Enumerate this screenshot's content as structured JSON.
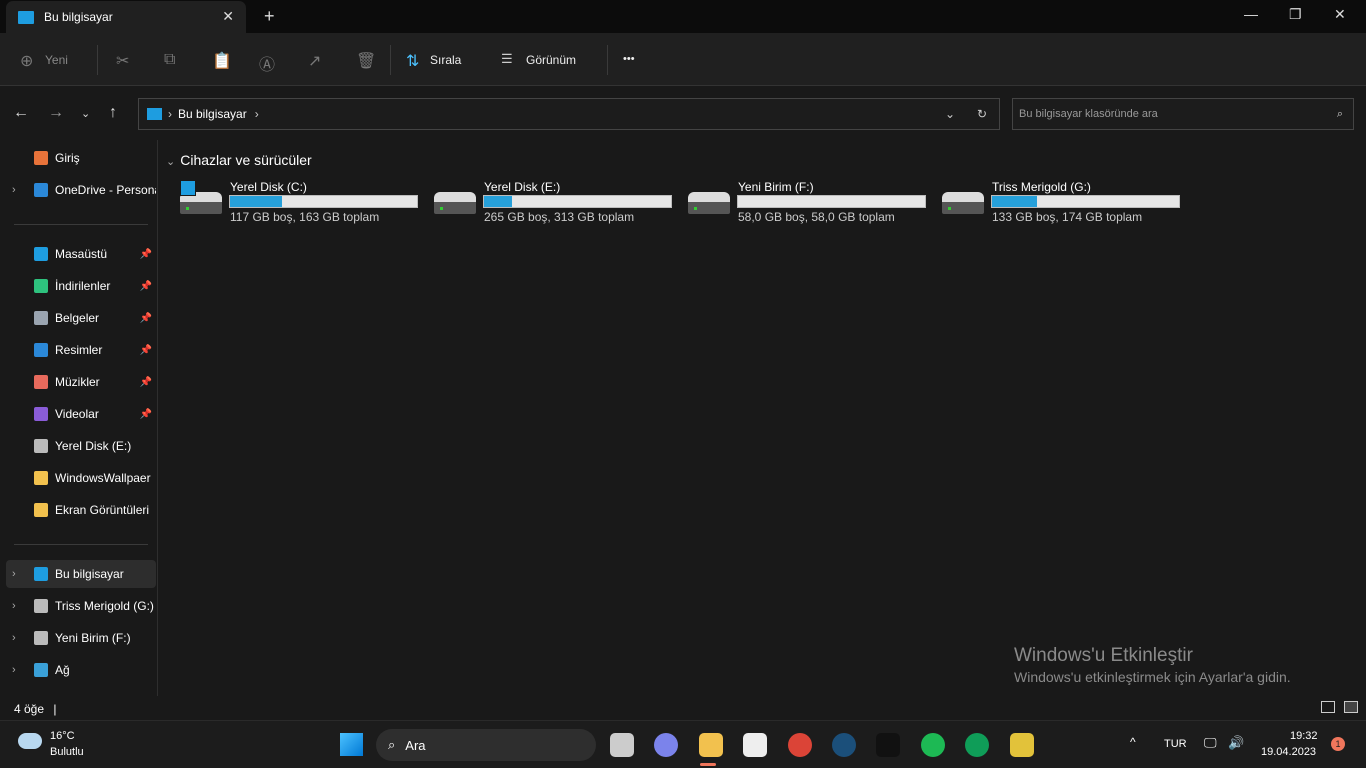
{
  "window": {
    "tab_title": "Bu bilgisayar",
    "new_tab": "+",
    "close_tab": "✕",
    "minimize": "—",
    "maximize": "❐",
    "close": "✕"
  },
  "toolbar": {
    "new_label": "Yeni",
    "sort_label": "Sırala",
    "view_label": "Görünüm",
    "more": "•••"
  },
  "address": {
    "crumb": "Bu bilgisayar",
    "search_placeholder": "Bu bilgisayar klasöründe ara"
  },
  "sidebar": {
    "items": [
      {
        "label": "Giriş",
        "color": "#e8733a"
      },
      {
        "label": "OneDrive - Persona",
        "color": "#2b88d8",
        "chev": true
      },
      {
        "label": "Masaüstü",
        "color": "#1e9de0",
        "pin": true
      },
      {
        "label": "İndirilenler",
        "color": "#2ec27e",
        "pin": true
      },
      {
        "label": "Belgeler",
        "color": "#9aa4b0",
        "pin": true
      },
      {
        "label": "Resimler",
        "color": "#2b88d8",
        "pin": true
      },
      {
        "label": "Müzikler",
        "color": "#e86a5c",
        "pin": true
      },
      {
        "label": "Videolar",
        "color": "#8a5cd8",
        "pin": true
      },
      {
        "label": "Yerel Disk (E:)",
        "color": "#bbbbbb"
      },
      {
        "label": "WindowsWallpaer",
        "color": "#f2c14e"
      },
      {
        "label": "Ekran Görüntüleri",
        "color": "#f2c14e"
      },
      {
        "label": "Bu bilgisayar",
        "color": "#1e9de0",
        "chev": true
      },
      {
        "label": "Triss Merigold (G:)",
        "color": "#bbbbbb",
        "chev": true
      },
      {
        "label": "Yeni Birim (F:)",
        "color": "#bbbbbb",
        "chev": true
      },
      {
        "label": "Ağ",
        "color": "#3aa0d8",
        "chev": true
      }
    ]
  },
  "main": {
    "group_title": "Cihazlar ve sürücüler",
    "drives": [
      {
        "name": "Yerel Disk (C:)",
        "caption": "117 GB boş, 163 GB toplam",
        "used_fraction": 0.28
      },
      {
        "name": "Yerel Disk (E:)",
        "caption": "265 GB boş, 313 GB toplam",
        "used_fraction": 0.15
      },
      {
        "name": "Yeni Birim (F:)",
        "caption": "58,0 GB boş, 58,0 GB toplam",
        "used_fraction": 0.0
      },
      {
        "name": "Triss Merigold (G:)",
        "caption": "133 GB boş, 174 GB toplam",
        "used_fraction": 0.24
      }
    ]
  },
  "status": {
    "count": "4 öğe"
  },
  "watermark": {
    "title": "Windows'u Etkinleştir",
    "subtitle": "Windows'u etkinleştirmek için Ayarlar'a gidin."
  },
  "taskbar": {
    "temp": "16°C",
    "weather": "Bulutlu",
    "search": "Ara",
    "lang": "TUR",
    "time": "19:32",
    "date": "19.04.2023",
    "badge": "1",
    "apps": [
      {
        "name": "task-view",
        "color": "#cccccc"
      },
      {
        "name": "teams",
        "color": "#7b83eb"
      },
      {
        "name": "file-explorer",
        "color": "#f2c14e"
      },
      {
        "name": "microsoft-store",
        "color": "#eeeeee"
      },
      {
        "name": "chrome",
        "color": "#db4437"
      },
      {
        "name": "steam",
        "color": "#1b4f7a"
      },
      {
        "name": "epic-games",
        "color": "#111111"
      },
      {
        "name": "spotify",
        "color": "#1db954"
      },
      {
        "name": "chrome-profile",
        "color": "#0f9d58"
      },
      {
        "name": "app-tool",
        "color": "#e2c23a"
      }
    ]
  }
}
